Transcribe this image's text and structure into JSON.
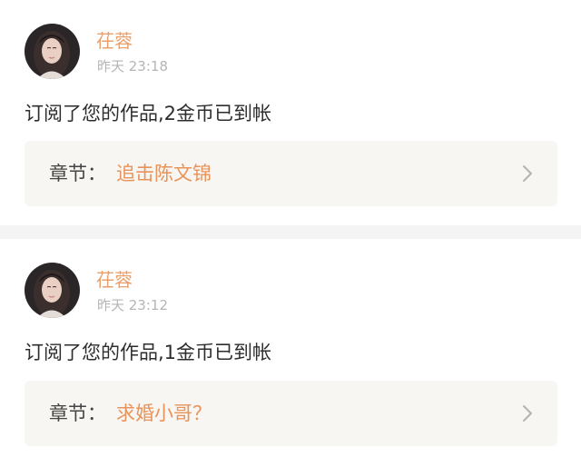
{
  "notifications": [
    {
      "username": "茌蓉",
      "time": "昨天 23:18",
      "message": "订阅了您的作品,2金币已到帐",
      "chapter_label": "章节：",
      "chapter_title": "追击陈文锦"
    },
    {
      "username": "茌蓉",
      "time": "昨天 23:12",
      "message": "订阅了您的作品,1金币已到帐",
      "chapter_label": "章节：",
      "chapter_title": "求婚小哥？"
    }
  ],
  "colors": {
    "accent": "#e8935a",
    "username": "#e8a06d",
    "timestamp": "#b5b5b5",
    "chapter_bg": "#f7f6f2",
    "separator": "#f4f4f4"
  },
  "icons": {
    "avatar": "user-avatar-icon",
    "chevron": "chevron-right-icon"
  }
}
